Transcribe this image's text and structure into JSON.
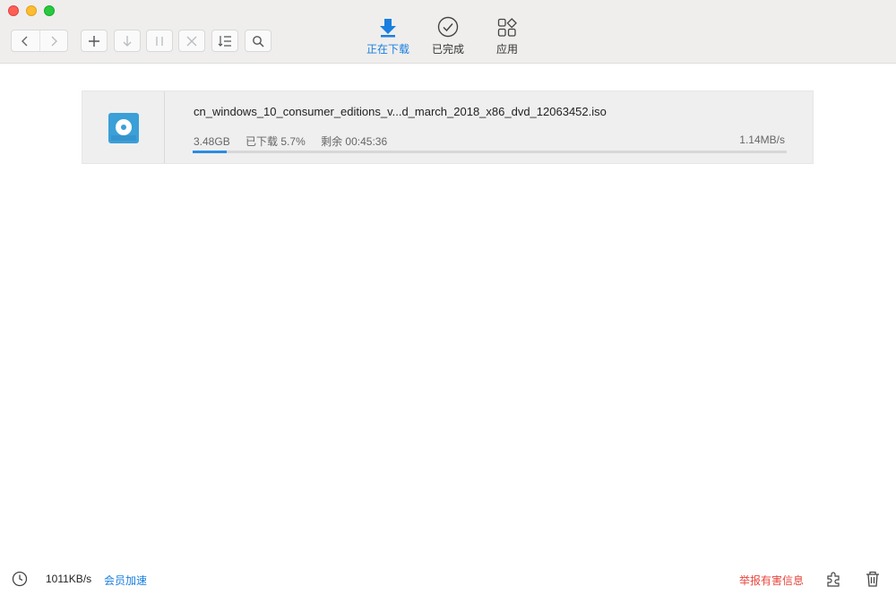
{
  "window": {
    "traffic_lights": [
      "close",
      "minimize",
      "maximize"
    ]
  },
  "toolbar": {
    "buttons": [
      {
        "name": "back",
        "icon": "chevron-left-icon"
      },
      {
        "name": "forward",
        "icon": "chevron-right-icon"
      },
      {
        "name": "new-task",
        "icon": "plus-icon"
      },
      {
        "name": "start",
        "icon": "arrow-down-icon"
      },
      {
        "name": "pause",
        "icon": "pause-icon"
      },
      {
        "name": "delete",
        "icon": "close-icon"
      },
      {
        "name": "sort",
        "icon": "list-sort-icon"
      },
      {
        "name": "search",
        "icon": "search-icon"
      }
    ],
    "tabs": [
      {
        "label": "正在下载",
        "icon": "download-icon",
        "active": true
      },
      {
        "label": "已完成",
        "icon": "check-circle-icon",
        "active": false
      },
      {
        "label": "应用",
        "icon": "apps-icon",
        "active": false
      }
    ]
  },
  "downloads": [
    {
      "filename": "cn_windows_10_consumer_editions_v...d_march_2018_x86_dvd_12063452.iso",
      "icon": "disc-icon",
      "size": "3.48GB",
      "downloaded": "已下载 5.7%",
      "remaining": "剩余 00:45:36",
      "speed": "1.14MB/s",
      "progress": 0.057
    }
  ],
  "status": {
    "total_speed": "1011KB/s",
    "vip_accelerate": "会员加速",
    "report": "举报有害信息"
  },
  "colors": {
    "accent": "#1a7fe0",
    "report": "#e8463c",
    "progress": "#2a8ce6",
    "file_icon": "#3b9fd8"
  }
}
